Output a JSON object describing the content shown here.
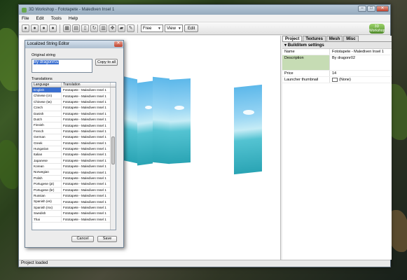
{
  "window": {
    "title": "3D Workshop - Fototapete - Malediven Insel 1",
    "min": "–",
    "max": "□",
    "close": "✕"
  },
  "menu": [
    "File",
    "Edit",
    "Tools",
    "Help"
  ],
  "toolbar": {
    "view_mode": "Free",
    "view_combo": "View",
    "edit_label": "Edit"
  },
  "logo_text": "3D Workshop",
  "tabs": [
    "Project",
    "Textures",
    "Mesh",
    "Misc"
  ],
  "properties": {
    "section": "Builditem settings",
    "rows": [
      {
        "key": "Name",
        "value": "Fototapete - Malediven Insel 1"
      },
      {
        "key": "Description",
        "value": "By dragonr02"
      },
      {
        "key": "Price",
        "value": "14"
      },
      {
        "key": "Launcher thumbnail",
        "value": "(None)"
      }
    ]
  },
  "status": "Project loaded",
  "dialog": {
    "title": "Localized String Editor",
    "close": "✕",
    "original_label": "Original string",
    "original_value": "By dragonr02",
    "copy_button": "Copy to all",
    "translations_label": "Translations",
    "col_language": "Language",
    "col_translation": "Translation",
    "cancel": "Cancel",
    "save": "Save",
    "rows": [
      {
        "lang": "English",
        "text": "Fototapete - Malediven Insel 1"
      },
      {
        "lang": "Chinese (cn)",
        "text": "Fototapete - Malediven Insel 1"
      },
      {
        "lang": "Chinese (tw)",
        "text": "Fototapete - Malediven Insel 1"
      },
      {
        "lang": "Czech",
        "text": "Fototapete - Malediven Insel 1"
      },
      {
        "lang": "Danish",
        "text": "Fototapete - Malediven Insel 1"
      },
      {
        "lang": "Dutch",
        "text": "Fototapete - Malediven Insel 1"
      },
      {
        "lang": "Finnish",
        "text": "Fototapete - Malediven Insel 1"
      },
      {
        "lang": "French",
        "text": "Fototapete - Malediven Insel 1"
      },
      {
        "lang": "German",
        "text": "Fototapete - Malediven Insel 1"
      },
      {
        "lang": "Greek",
        "text": "Fototapete - Malediven Insel 1"
      },
      {
        "lang": "Hungarian",
        "text": "Fototapete - Malediven Insel 1"
      },
      {
        "lang": "Italian",
        "text": "Fototapete - Malediven Insel 1"
      },
      {
        "lang": "Japanese",
        "text": "Fototapete - Malediven Insel 1"
      },
      {
        "lang": "Korean",
        "text": "Fototapete - Malediven Insel 1"
      },
      {
        "lang": "Norwegian",
        "text": "Fototapete - Malediven Insel 1"
      },
      {
        "lang": "Polish",
        "text": "Fototapete - Malediven Insel 1"
      },
      {
        "lang": "Portugese (pt)",
        "text": "Fototapete - Malediven Insel 1"
      },
      {
        "lang": "Portugese (br)",
        "text": "Fototapete - Malediven Insel 1"
      },
      {
        "lang": "Russian",
        "text": "Fototapete - Malediven Insel 1"
      },
      {
        "lang": "Spanish (es)",
        "text": "Fototapete - Malediven Insel 1"
      },
      {
        "lang": "Spanish (mx)",
        "text": "Fototapete - Malediven Insel 1"
      },
      {
        "lang": "Swedish",
        "text": "Fototapete - Malediven Insel 1"
      },
      {
        "lang": "Thai",
        "text": "Fototapete - Malediven Insel 1"
      }
    ]
  },
  "colors": {
    "selection": "#3a6fd0",
    "sea": "#2aa4b4",
    "sky": "#5db8ea"
  }
}
